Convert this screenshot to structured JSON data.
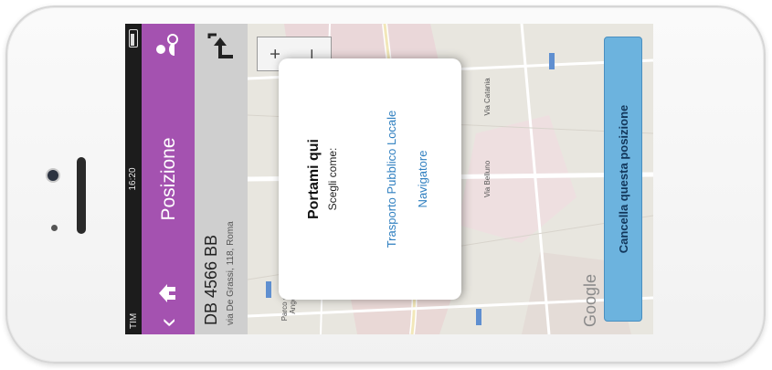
{
  "status_bar": {
    "carrier": "TIM",
    "time": "16:20"
  },
  "header": {
    "title": "Posizione"
  },
  "vehicle": {
    "plate": "DB 4566 BB",
    "address": "via De Grassi, 118, Roma"
  },
  "map": {
    "labels": [
      "Parco di Villa Angeletti",
      "Via Belluno",
      "Via Catania"
    ],
    "zoom_in": "+",
    "zoom_out": "−",
    "attribution": "Google"
  },
  "dialog": {
    "title": "Portami qui",
    "subtitle": "Scegli come:",
    "options": [
      "Trasporto Pubblico Locale",
      "Navigatore"
    ]
  },
  "cancel_button": {
    "label": "Cancella questa posizione"
  },
  "colors": {
    "header": "#a452b0",
    "cancel": "#6cb3de",
    "link": "#2f7fc0"
  }
}
